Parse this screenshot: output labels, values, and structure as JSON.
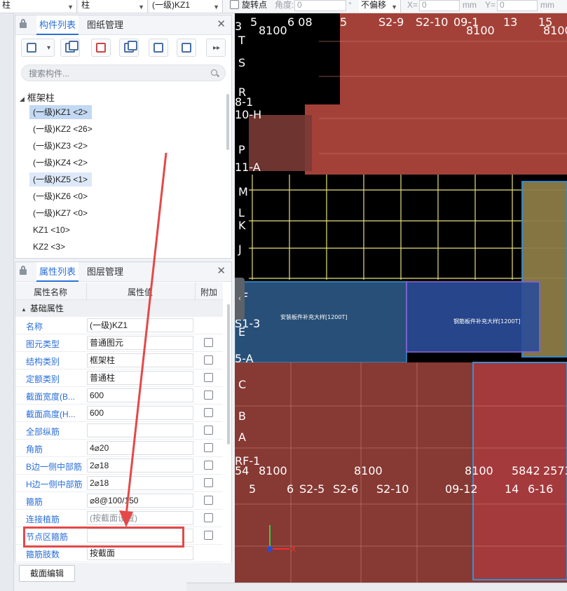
{
  "toolbar": {
    "select1": "柱",
    "select2": "柱",
    "select3": "(一级)KZ1",
    "rotate_label": "旋转点",
    "angle_label": "角度:",
    "angle_value": "0",
    "degree": "°",
    "offset_select": "不偏移",
    "x_label": "X=",
    "x_value": "0",
    "y_label": "Y=",
    "y_value": "0",
    "unit1": "mm",
    "unit2": "mm"
  },
  "component_panel": {
    "tab_active": "构件列表",
    "tab_other": "图纸管理",
    "search_placeholder": "搜索构件...",
    "tree_group": "框架柱",
    "items": [
      {
        "label": "(一级)KZ1 <2>",
        "state": "selected"
      },
      {
        "label": "(一级)KZ2 <26>",
        "state": ""
      },
      {
        "label": "(一级)KZ3 <2>",
        "state": ""
      },
      {
        "label": "(一级)KZ4 <2>",
        "state": ""
      },
      {
        "label": "(一级)KZ5 <1>",
        "state": "highlight"
      },
      {
        "label": "(一级)KZ6 <0>",
        "state": ""
      },
      {
        "label": "(一级)KZ7 <0>",
        "state": ""
      },
      {
        "label": "KZ1 <10>",
        "state": ""
      },
      {
        "label": "KZ2 <3>",
        "state": ""
      }
    ]
  },
  "property_panel": {
    "tab_active": "属性列表",
    "tab_other": "图层管理",
    "col_name": "属性名称",
    "col_value": "属性值",
    "col_extra": "附加",
    "group": "基础属性",
    "rows": [
      {
        "name": "名称",
        "value": "(一级)KZ1",
        "check": false,
        "placeholder": false
      },
      {
        "name": "图元类型",
        "value": "普通图元",
        "check": true,
        "placeholder": false
      },
      {
        "name": "结构类别",
        "value": "框架柱",
        "check": true,
        "placeholder": false
      },
      {
        "name": "定额类别",
        "value": "普通柱",
        "check": true,
        "placeholder": false
      },
      {
        "name": "截面宽度(B...",
        "value": "600",
        "check": true,
        "placeholder": false
      },
      {
        "name": "截面高度(H...",
        "value": "600",
        "check": true,
        "placeholder": false
      },
      {
        "name": "全部纵筋",
        "value": "",
        "check": true,
        "placeholder": false
      },
      {
        "name": "角筋",
        "value": "4⌀20",
        "check": true,
        "placeholder": false
      },
      {
        "name": "B边一侧中部筋",
        "value": "2⌀18",
        "check": true,
        "placeholder": false
      },
      {
        "name": "H边一侧中部筋",
        "value": "2⌀18",
        "check": true,
        "placeholder": false
      },
      {
        "name": "箍筋",
        "value": "⌀8@100/150",
        "check": true,
        "placeholder": false
      },
      {
        "name": "连接植筋",
        "value": "(按截面设置)",
        "check": true,
        "placeholder": true
      },
      {
        "name": "节点区箍筋",
        "value": "",
        "check": true,
        "placeholder": false
      },
      {
        "name": "箍筋肢数",
        "value": "按截面",
        "check": false,
        "placeholder": false
      }
    ],
    "edit_button": "截面编辑"
  },
  "cad": {
    "top_labels": [
      "3",
      "5",
      "8100",
      "6 08",
      "5",
      "S2-9",
      "S2-10",
      "09-1",
      "8100",
      "13",
      "15",
      "8100"
    ],
    "left_labels": [
      "T",
      "S",
      "R",
      "8-1",
      "10-H",
      "P",
      "11-A",
      "M",
      "L",
      "K",
      "J",
      "F",
      "S1-3",
      "E",
      "5-A",
      "C",
      "B",
      "A",
      "RF-1"
    ],
    "bottom_dims": [
      "54",
      "8100",
      "8100",
      "8100",
      "5842",
      "2573"
    ],
    "bottom_labels": [
      "5",
      "6",
      "S2-5",
      "S2-6",
      "S2-10",
      "09-12",
      "14",
      "6-16"
    ],
    "annotation1": "安装板件补充大样[1200T]",
    "annotation2": "钢筋板件补充大样[1200T]",
    "axis_x": "X",
    "collapse_glyph": "‹"
  },
  "colors": {
    "accent": "#2a6fd8",
    "highlight_box": "#e54848",
    "cad_red": "#b5483e",
    "cad_blue": "#2f5d8c",
    "cad_olive": "#8d7c46"
  }
}
